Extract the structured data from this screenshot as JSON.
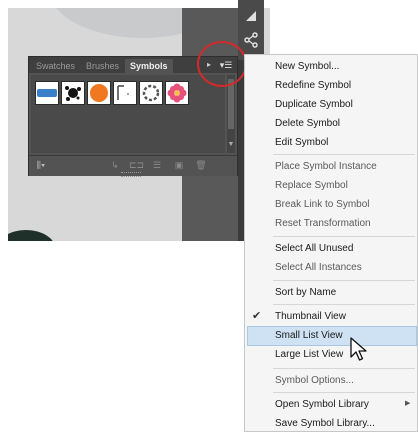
{
  "panel": {
    "tabs": [
      {
        "label": "Swatches"
      },
      {
        "label": "Brushes"
      },
      {
        "label": "Symbols"
      }
    ],
    "symbols": [
      "blue-bar-symbol",
      "splatter-symbol",
      "orange-circle-symbol",
      "bracket-symbol",
      "ring-symbol",
      "flower-symbol"
    ]
  },
  "menu": {
    "items": [
      {
        "label": "New Symbol..."
      },
      {
        "label": "Redefine Symbol"
      },
      {
        "label": "Duplicate Symbol"
      },
      {
        "label": "Delete Symbol"
      },
      {
        "label": "Edit Symbol"
      },
      {
        "label": "Place Symbol Instance"
      },
      {
        "label": "Replace Symbol"
      },
      {
        "label": "Break Link to Symbol"
      },
      {
        "label": "Reset Transformation"
      },
      {
        "label": "Select All Unused"
      },
      {
        "label": "Select All Instances"
      },
      {
        "label": "Sort by Name"
      },
      {
        "label": "Thumbnail View"
      },
      {
        "label": "Small List View"
      },
      {
        "label": "Large List View"
      },
      {
        "label": "Symbol Options..."
      },
      {
        "label": "Open Symbol Library"
      },
      {
        "label": "Save Symbol Library..."
      }
    ],
    "checked_item": "Thumbnail View",
    "highlighted_item": "Small List View"
  }
}
